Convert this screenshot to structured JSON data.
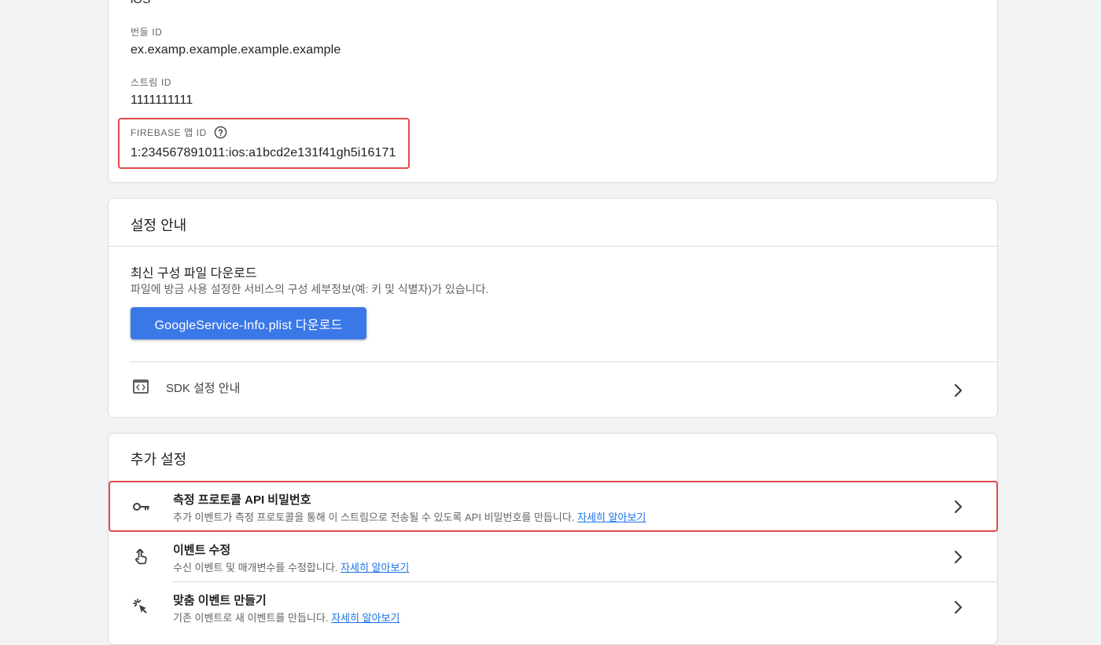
{
  "details": {
    "platform_value": "iOS",
    "bundle_id_label": "번들 ID",
    "bundle_id_value": "ex.examp.example.example.example",
    "stream_id_label": "스트림 ID",
    "stream_id_value": "1111111111",
    "firebase_app_id_label": "FIREBASE 앱 ID",
    "firebase_app_id_value": "1:234567891011:ios:a1bcd2e131f41gh5i16171",
    "help_icon": "help-circle-icon"
  },
  "setup": {
    "title": "설정 안내",
    "download_heading": "최신 구성 파일 다운로드",
    "download_desc": "파일에 방금 사용 설정한 서비스의 구성 세부정보(예: 키 및 식별자)가 있습니다.",
    "download_button": "GoogleService-Info.plist 다운로드",
    "sdk_row_label": "SDK 설정 안내",
    "sdk_icon": "code-icon"
  },
  "more": {
    "title": "추가 설정",
    "items": [
      {
        "title": "측정 프로토콜 API 비밀번호",
        "desc": "추가 이벤트가 측정 프로토콜을 통해 이 스트림으로 전송될 수 있도록 API 비밀번호를 만듭니다.",
        "link": "자세히 알아보기",
        "icon": "key-icon"
      },
      {
        "title": "이벤트 수정",
        "desc": "수신 이벤트 및 매개변수를 수정합니다.",
        "link": "자세히 알아보기",
        "icon": "touch-hand-icon"
      },
      {
        "title": "맞춤 이벤트 만들기",
        "desc": "기존 이벤트로 새 이벤트를 만듭니다.",
        "link": "자세히 알아보기",
        "icon": "click-sparkle-icon"
      }
    ]
  },
  "colors": {
    "primary": "#3b78e7",
    "link": "#1a73e8",
    "highlight": "#e24b4b",
    "background": "#f1f3f4"
  }
}
